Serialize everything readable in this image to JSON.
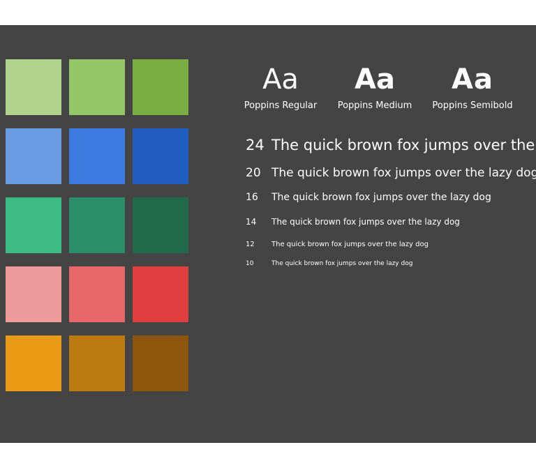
{
  "colors": {
    "background": "#444444",
    "text": "#ffffff"
  },
  "swatches": [
    "#b0d48c",
    "#94c566",
    "#7aae42",
    "#6a9ce6",
    "#3b7bdf",
    "#215dc0",
    "#3dbb85",
    "#2a8e68",
    "#22684a",
    "#ef9a9a",
    "#e8686a",
    "#df3f3f",
    "#eb9a16",
    "#bd7a10",
    "#8c560c"
  ],
  "fonts": [
    {
      "sample": "Aa",
      "name": "Poppins Regular"
    },
    {
      "sample": "Aa",
      "name": "Poppins Medium"
    },
    {
      "sample": "Aa",
      "name": "Poppins Semibold"
    }
  ],
  "type_scale": [
    {
      "size": "24",
      "sample": "The quick brown fox jumps over the lazy dog"
    },
    {
      "size": "20",
      "sample": "The quick brown fox jumps over the lazy dog"
    },
    {
      "size": "16",
      "sample": "The quick brown fox jumps over the lazy dog"
    },
    {
      "size": "14",
      "sample": "The quick brown fox jumps over the lazy dog"
    },
    {
      "size": "12",
      "sample": "The quick brown fox jumps over the lazy dog"
    },
    {
      "size": "10",
      "sample": "The quick brown fox jumps over the lazy dog"
    }
  ]
}
